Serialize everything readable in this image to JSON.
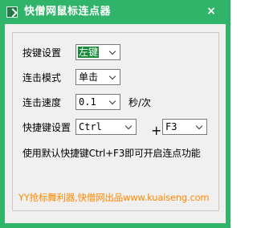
{
  "window": {
    "title": "快僧网鼠标连点器",
    "close_glyph": "×",
    "accent_color": "#2fb46a"
  },
  "form": {
    "button_setting": {
      "label": "按键设置",
      "value": "左键"
    },
    "click_mode": {
      "label": "连击模式",
      "value": "单击"
    },
    "click_speed": {
      "label": "连击速度",
      "value": "0.1",
      "unit": "秒/次"
    },
    "hotkey": {
      "label": "快捷键设置",
      "modifier": "Ctrl",
      "plus": "+",
      "key": "F3"
    }
  },
  "hint_text": "使用默认快捷键Ctrl+F3即可开启连点功能",
  "footer_text": "YY抢标舞利器,快僧网出品www.kuaiseng.com",
  "icons": {
    "app": "app-icon",
    "close": "close-icon",
    "dropdown": "chevron-down-icon"
  }
}
